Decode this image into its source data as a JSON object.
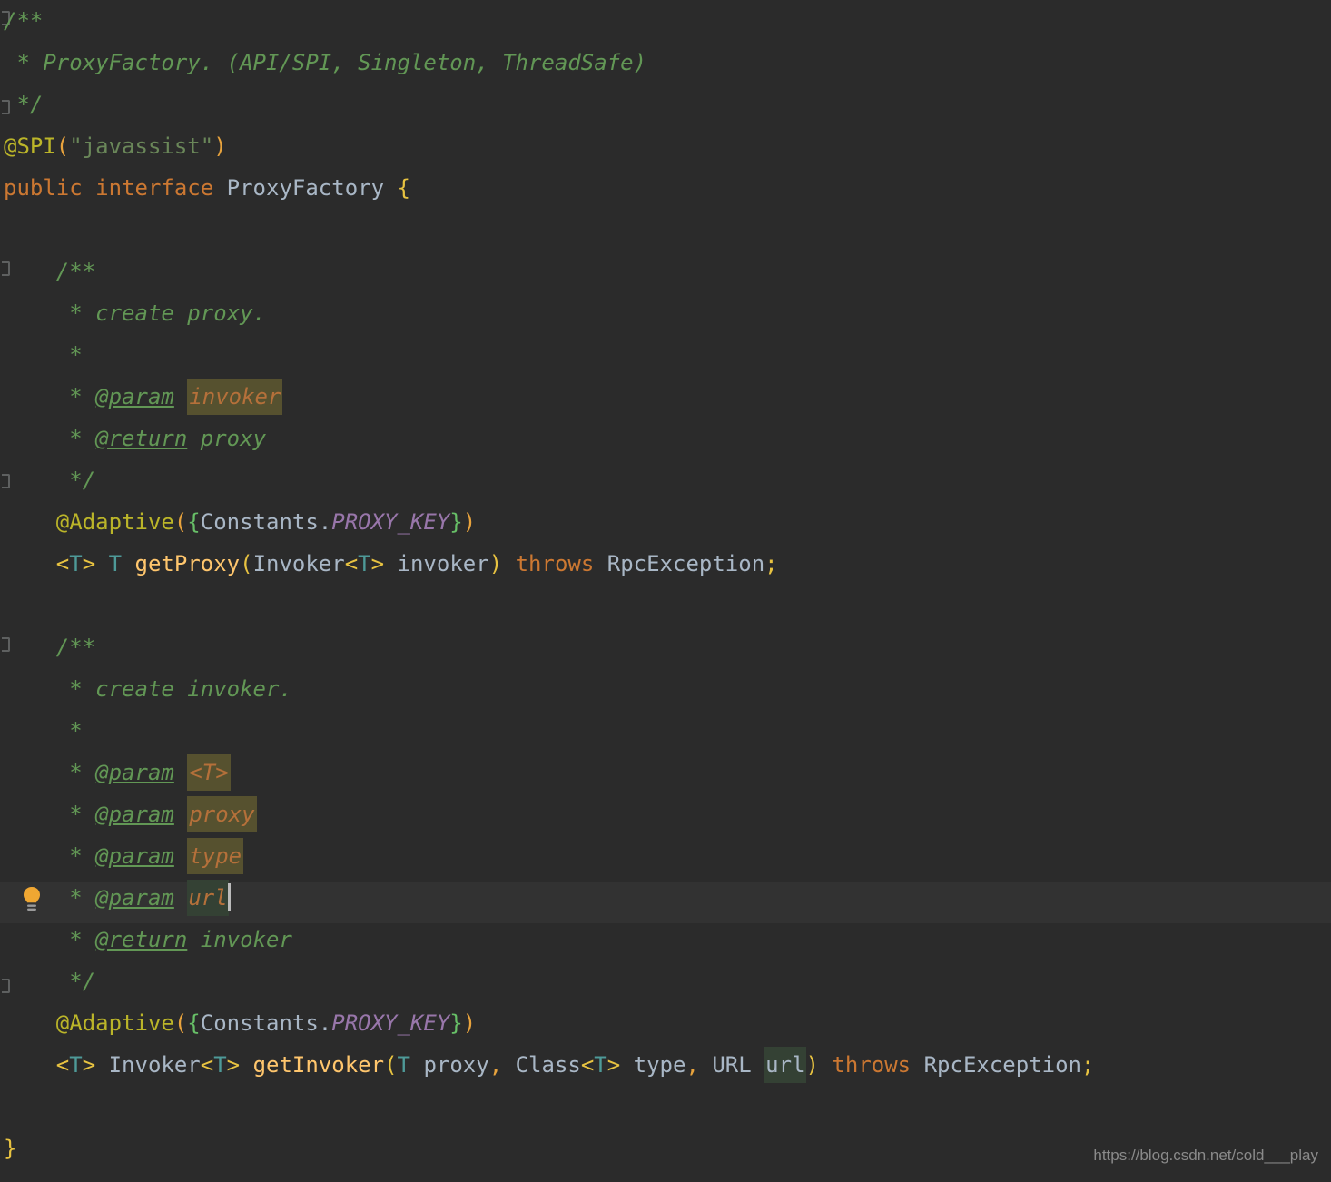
{
  "editor": {
    "theme": "darcula",
    "background_color": "#2b2b2b",
    "current_line_color": "#323232",
    "caret_color": "#bbbbbb",
    "highlight_warning_color": "#56512f",
    "highlight_occurrence_color": "#344134",
    "language": "java",
    "gutter_icon": "lightbulb-icon",
    "current_line_number": 23
  },
  "code": {
    "l1": {
      "comment": "/**"
    },
    "l2": {
      "comment": " * ProxyFactory. (API/SPI, Singleton, ThreadSafe)"
    },
    "l3": {
      "comment": " */"
    },
    "l4": {
      "annotation": "@SPI",
      "open": "(",
      "string": "\"javassist\"",
      "close": ")"
    },
    "l5": {
      "kw1": "public",
      "kw2": "interface",
      "name": "ProxyFactory",
      "brace": "{"
    },
    "l6": {
      "text": ""
    },
    "l7": {
      "comment": "/**"
    },
    "l8": {
      "comment": "* create proxy."
    },
    "l9": {
      "comment": "*"
    },
    "l10": {
      "star": "*",
      "tag": "@param",
      "value": "invoker"
    },
    "l11": {
      "star": "*",
      "tag": "@return",
      "value": "proxy"
    },
    "l12": {
      "comment": "*/"
    },
    "l13": {
      "annotation": "@Adaptive",
      "open": "(",
      "lbrace": "{",
      "cls": "Constants.",
      "constant": "PROXY_KEY",
      "rbrace": "}",
      "close": ")"
    },
    "l14": {
      "lt1": "<",
      "t1": "T",
      "gt1": ">",
      "ret": "T",
      "method": "getProxy",
      "lparen": "(",
      "ptype": "Invoker",
      "lt2": "<",
      "t2": "T",
      "gt2": ">",
      "pname": "invoker",
      "rparen": ")",
      "throws": "throws",
      "exception": "RpcException",
      "semi": ";"
    },
    "l15": {
      "text": ""
    },
    "l16": {
      "comment": "/**"
    },
    "l17": {
      "comment": "* create invoker."
    },
    "l18": {
      "comment": "*"
    },
    "l19": {
      "star": "*",
      "tag": "@param",
      "value": "<T>"
    },
    "l20": {
      "star": "*",
      "tag": "@param",
      "value": "proxy"
    },
    "l21": {
      "star": "*",
      "tag": "@param",
      "value": "type"
    },
    "l22": {
      "star": "*",
      "tag": "@param",
      "value": "url"
    },
    "l23": {
      "star": "*",
      "tag": "@return",
      "value": "invoker"
    },
    "l24": {
      "comment": "*/"
    },
    "l25": {
      "annotation": "@Adaptive",
      "open": "(",
      "lbrace": "{",
      "cls": "Constants.",
      "constant": "PROXY_KEY",
      "rbrace": "}",
      "close": ")"
    },
    "l26": {
      "lt1": "<",
      "t1": "T",
      "gt1": ">",
      "ret": "Invoker",
      "lt2": "<",
      "t2": "T",
      "gt2": ">",
      "method": "getInvoker",
      "lparen": "(",
      "p1type": "T",
      "p1name": "proxy",
      "c1": ",",
      "p2type": "Class",
      "lt3": "<",
      "t3": "T",
      "gt3": ">",
      "p2name": "type",
      "c2": ",",
      "p3type": "URL",
      "p3name": "url",
      "rparen": ")",
      "throws": "throws",
      "exception": "RpcException",
      "semi": ";"
    },
    "l27": {
      "text": ""
    },
    "l28": {
      "brace": "}"
    }
  },
  "watermark": {
    "url": "https://blog.csdn.net/cold___play"
  }
}
